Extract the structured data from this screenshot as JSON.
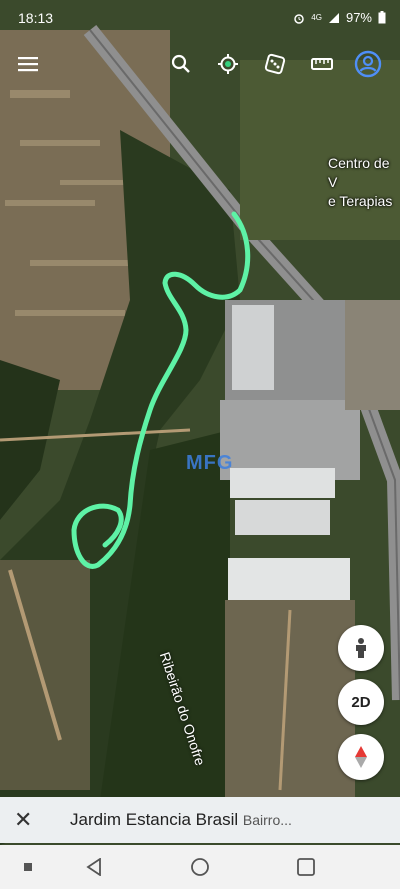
{
  "status_bar": {
    "time": "18:13",
    "battery": "97%",
    "network": "4G",
    "icons": [
      "alarm-icon",
      "signal-icon",
      "battery-icon"
    ]
  },
  "toolbar": {
    "icons": [
      "menu-icon",
      "search-icon",
      "voyager-icon",
      "random-dice-icon",
      "ruler-icon",
      "account-icon"
    ]
  },
  "map": {
    "place_labels": [
      "Centro de V",
      "e Terapias"
    ],
    "river_label": "Ribeirão do Onofre",
    "watermark": "MFG",
    "route_color": "#5ef2a6"
  },
  "controls": {
    "pegman": "pegman-icon",
    "dimension_toggle": "2D",
    "compass": "compass-icon"
  },
  "search": {
    "query": "Jardim Estancia Brasil",
    "subtitle": "Bairro..."
  },
  "nav_bar": {
    "icons": [
      "recents-square-icon",
      "back-triangle-icon",
      "home-circle-icon",
      "overview-square-icon"
    ]
  }
}
